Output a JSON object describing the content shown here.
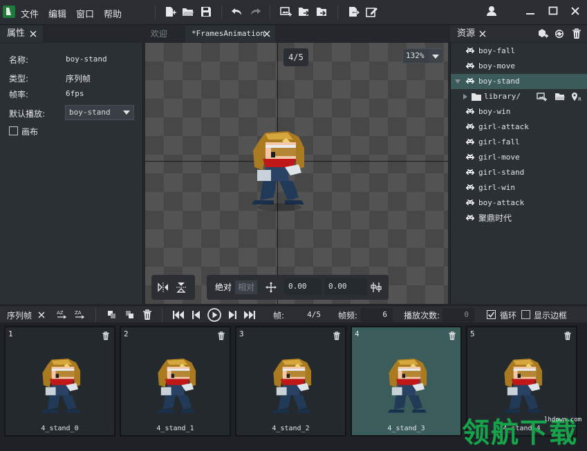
{
  "menu": {
    "items": [
      "文件",
      "编辑",
      "窗口",
      "帮助"
    ]
  },
  "left_panel": {
    "tab": "属性",
    "name_label": "名称:",
    "name_value": "boy-stand",
    "type_label": "类型:",
    "type_value": "序列帧",
    "fps_label": "帧率:",
    "fps_value": "6fps",
    "default_play_label": "默认播放:",
    "default_play_value": "boy-stand",
    "canvas_label": "画布"
  },
  "center": {
    "tabs": [
      "欢迎",
      "*FramesAnimation"
    ],
    "frame_counter": "4/5",
    "zoom": "132%",
    "mode_absolute": "绝对",
    "mode_relative": "相对",
    "offset_x": "0.00",
    "offset_y": "0.00"
  },
  "right_panel": {
    "tab": "资源",
    "items": [
      "boy-fall",
      "boy-move",
      "boy-stand",
      "library/",
      "boy-win",
      "girl-attack",
      "girl-fall",
      "girl-move",
      "girl-stand",
      "girl-win",
      "boy-attack",
      "聚鼎时代"
    ]
  },
  "timeline": {
    "tab": "序列帧",
    "frame_label": "帧:",
    "frame_value": "4/5",
    "rate_label": "帧频:",
    "rate_value": "6",
    "play_count_label": "播放次数:",
    "play_count_value": "0",
    "loop_label": "循环",
    "show_border_label": "显示边框"
  },
  "frames": [
    {
      "index": "1",
      "name": "4_stand_0"
    },
    {
      "index": "2",
      "name": "4_stand_1"
    },
    {
      "index": "3",
      "name": "4_stand_2"
    },
    {
      "index": "4",
      "name": "4_stand_3"
    },
    {
      "index": "5",
      "name": "4_stand_4"
    }
  ],
  "watermark": {
    "text": "领航下载",
    "url": "lhdown.com"
  },
  "colors": {
    "accent": "#3b5a5a",
    "watermark": "#16a34a",
    "background": "#23272c"
  }
}
